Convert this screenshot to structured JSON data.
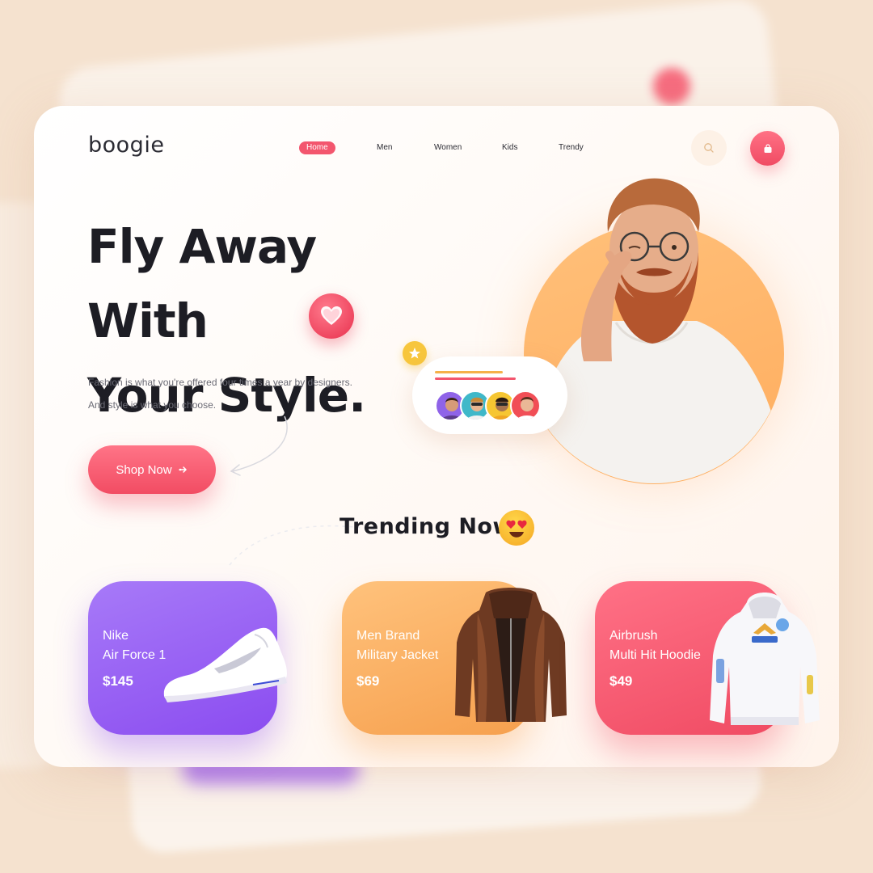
{
  "brand": {
    "logo": "boogie"
  },
  "nav": {
    "items": [
      {
        "label": "Home",
        "active": true
      },
      {
        "label": "Men",
        "active": false
      },
      {
        "label": "Women",
        "active": false
      },
      {
        "label": "Kids",
        "active": false
      },
      {
        "label": "Trendy",
        "active": false
      }
    ]
  },
  "header": {
    "search_icon": "search-icon",
    "cart_icon": "shopping-bag-icon"
  },
  "hero": {
    "title_line1": "Fly Away With",
    "title_line2": "Your Style.",
    "description_line1": "Fashion is what you're offered four times a year by designers.",
    "description_line2": "And style is what you choose.",
    "cta_label": "Shop Now",
    "cta_icon": "arrow-right-icon"
  },
  "trending": {
    "title": "Trending Now",
    "products": [
      {
        "name": "Nike\nAir Force 1",
        "price": "$145",
        "icon": "sneaker-icon"
      },
      {
        "name": "Men Brand\nMilitary Jacket",
        "price": "$69",
        "icon": "jacket-icon"
      },
      {
        "name": "Airbrush\nMulti Hit Hoodie",
        "price": "$49",
        "icon": "hoodie-icon"
      }
    ]
  },
  "colors": {
    "accent": "#f3566e",
    "orange": "#ffad5e",
    "purple": "#8b4cf0",
    "background": "#f5e2cf"
  }
}
